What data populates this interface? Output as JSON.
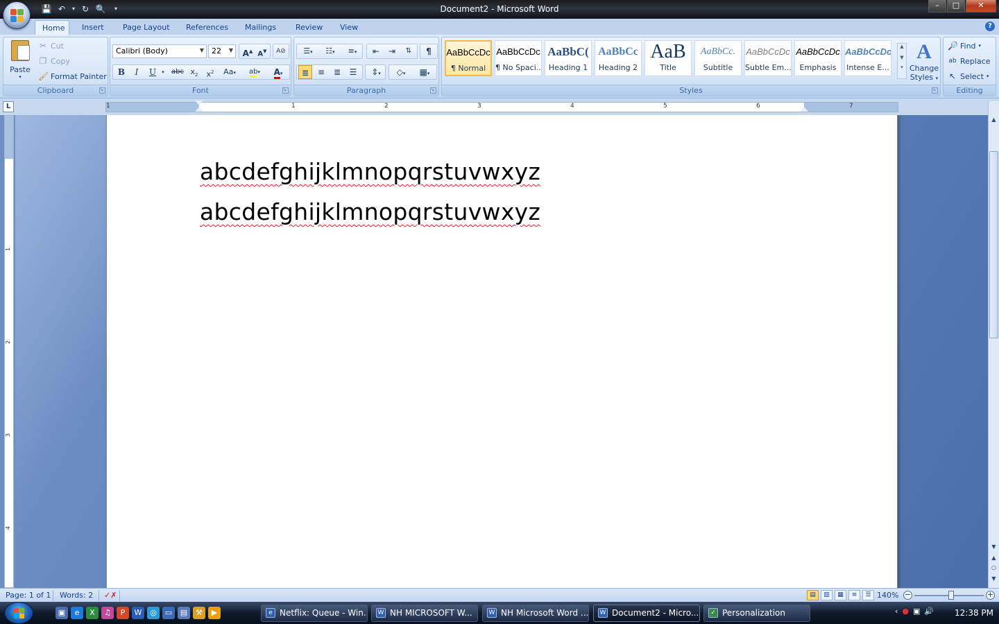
{
  "window": {
    "title": "Document2 - Microsoft Word",
    "buttons": [
      "minimize",
      "maximize",
      "close"
    ]
  },
  "tabs": [
    {
      "label": "Home",
      "active": true
    },
    {
      "label": "Insert"
    },
    {
      "label": "Page Layout"
    },
    {
      "label": "References"
    },
    {
      "label": "Mailings"
    },
    {
      "label": "Review"
    },
    {
      "label": "View"
    }
  ],
  "clipboard": {
    "label": "Clipboard",
    "paste": "Paste",
    "cut": "Cut",
    "copy": "Copy",
    "format_painter": "Format Painter"
  },
  "font": {
    "label": "Font",
    "family": "Calibri (Body)",
    "size": "22",
    "change_case": "Aa"
  },
  "paragraph": {
    "label": "Paragraph"
  },
  "styles": {
    "label": "Styles",
    "items": [
      {
        "sample": "AaBbCcDc",
        "name": "¶ Normal"
      },
      {
        "sample": "AaBbCcDc",
        "name": "¶ No Spaci..."
      },
      {
        "sample": "AaBbC(",
        "name": "Heading 1"
      },
      {
        "sample": "AaBbCc",
        "name": "Heading 2"
      },
      {
        "sample": "AaB",
        "name": "Title"
      },
      {
        "sample": "AaBbCc.",
        "name": "Subtitle"
      },
      {
        "sample": "AaBbCcDc",
        "name": "Subtle Em..."
      },
      {
        "sample": "AaBbCcDc",
        "name": "Emphasis"
      },
      {
        "sample": "AaBbCcDc",
        "name": "Intense E..."
      }
    ],
    "change_styles_line1": "Change",
    "change_styles_line2": "Styles"
  },
  "editing": {
    "label": "Editing",
    "find": "Find",
    "replace": "Replace",
    "select": "Select"
  },
  "ruler": {
    "numbers": [
      "1",
      "1",
      "2",
      "3",
      "4",
      "5",
      "6",
      "7"
    ],
    "vertical_numbers": [
      "1",
      "2",
      "3",
      "4"
    ]
  },
  "document": {
    "lines": [
      "abcdefghijklmnopqrstuvwxyz",
      "abcdefghijklmnopqrstuvwxyz"
    ]
  },
  "status": {
    "page": "Page: 1 of 1",
    "words": "Words: 2",
    "zoom": "140%"
  },
  "taskbar": {
    "buttons": [
      {
        "label": "Netflix: Queue - Win..."
      },
      {
        "label": "NH MICROSOFT W..."
      },
      {
        "label": "NH Microsoft Word ..."
      },
      {
        "label": "Document2 - Micro...",
        "active": true
      },
      {
        "label": "Personalization"
      }
    ],
    "clock": "12:38 PM"
  }
}
